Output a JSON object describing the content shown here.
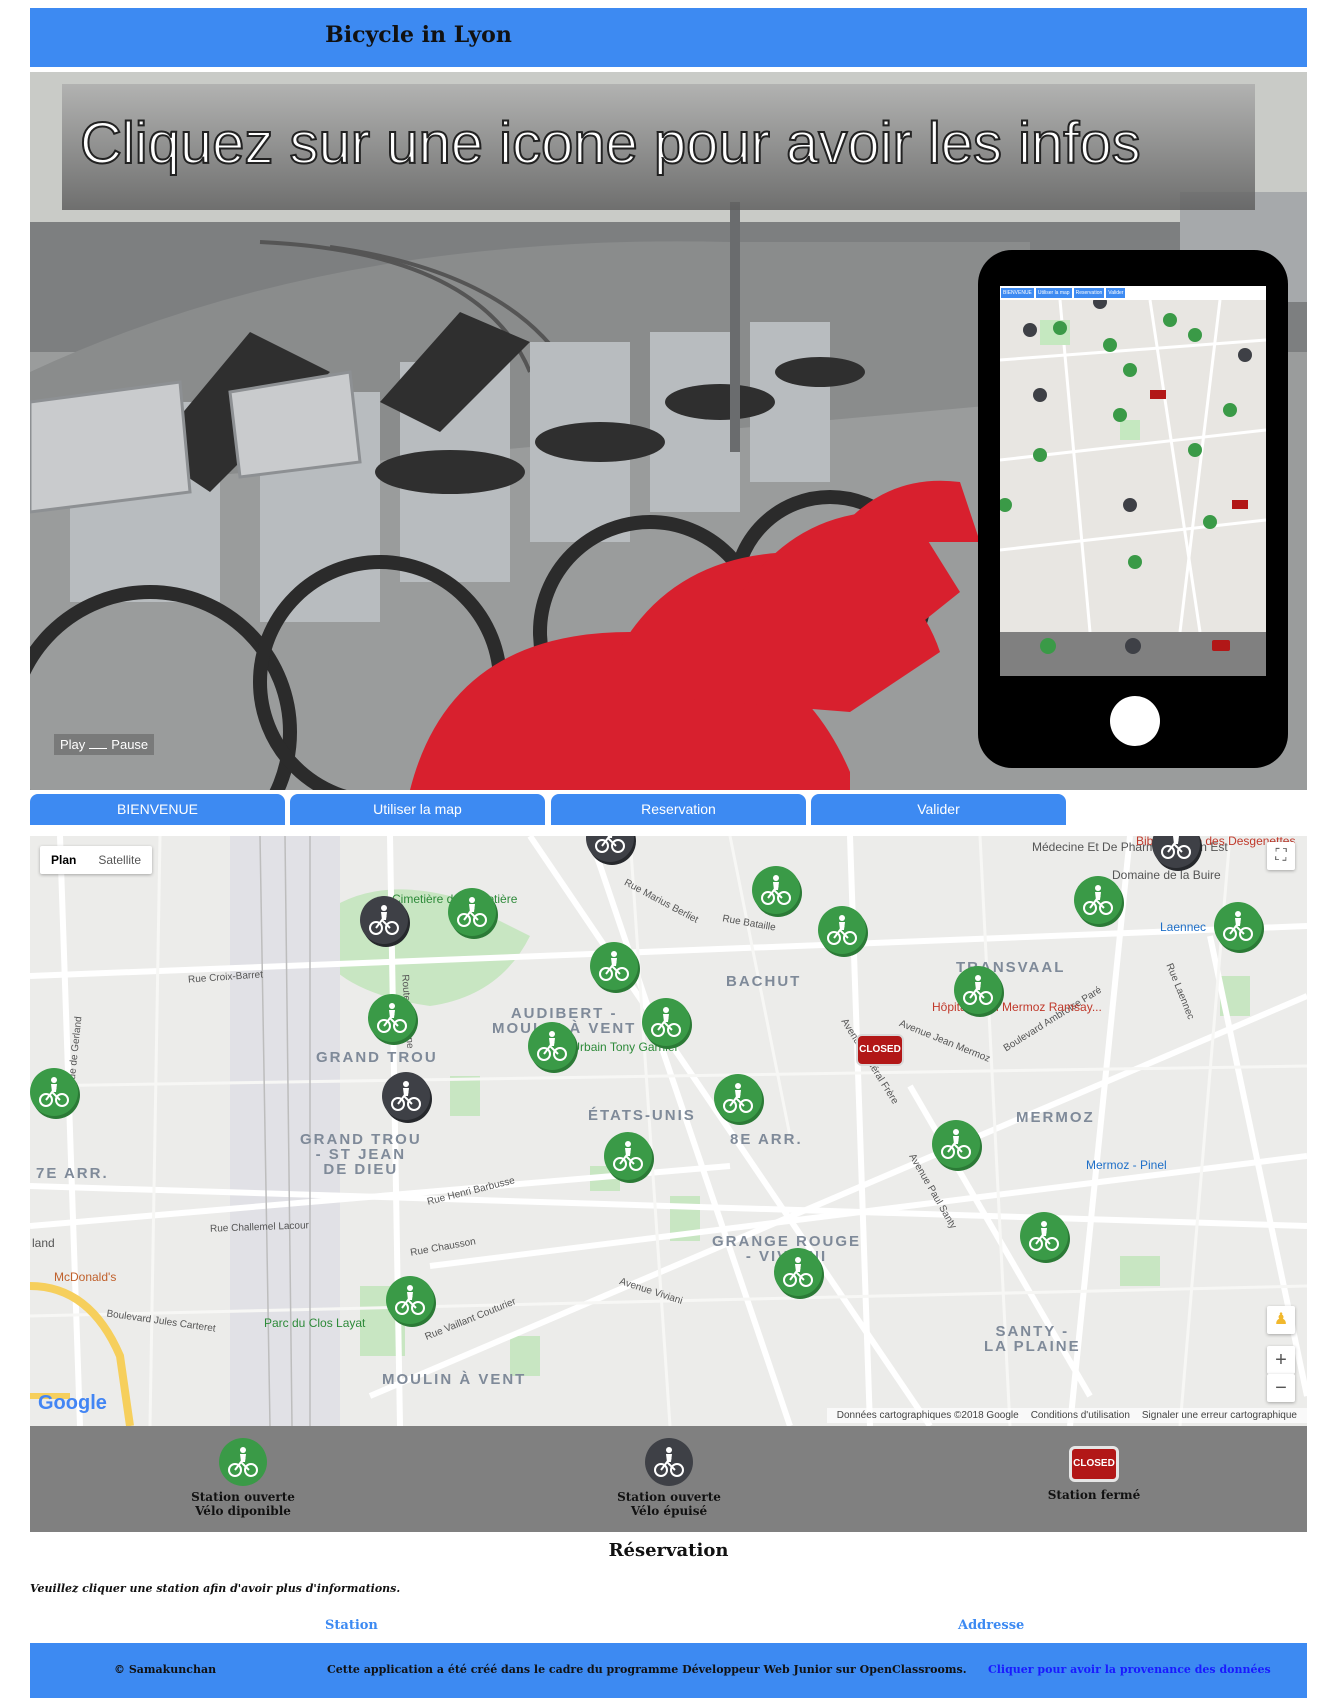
{
  "header": {
    "title": "Bicycle in Lyon"
  },
  "slider": {
    "banner_text": "Cliquez sur une icone pour avoir les infos",
    "play_label": "Play",
    "pause_label": "Pause"
  },
  "phone_preview": {
    "tabs": [
      "BIENVENUE",
      "Utiliser la map",
      "Reservation",
      "Valider"
    ]
  },
  "tabs": [
    {
      "label": "BIENVENUE"
    },
    {
      "label": "Utiliser la map"
    },
    {
      "label": "Reservation"
    },
    {
      "label": "Valider"
    }
  ],
  "map": {
    "map_type": {
      "plan": "Plan",
      "satellite": "Satellite"
    },
    "zoom_in": "+",
    "zoom_out": "−",
    "fullscreen_icon": "fullscreen-icon",
    "pegman_icon": "pegman-icon",
    "logo": "Google",
    "attribution": {
      "data": "Données cartographiques ©2018 Google",
      "terms": "Conditions d'utilisation",
      "report": "Signaler une erreur cartographique"
    },
    "closed_marker_label": "CLOSED",
    "districts": [
      "BACHUT",
      "TRANSVAAL",
      "AUDIBERT -\nMOULIN À VENT",
      "GRAND TROU",
      "ÉTATS-UNIS",
      "8E ARR.",
      "MERMOZ",
      "GRAND TROU\n- ST JEAN\nDE DIEU",
      "7E ARR.",
      "GRANGE ROUGE\n- VIVIANI",
      "SANTY -\nLA PLAINE",
      "MOULIN À VENT"
    ],
    "streets": [
      "Rue Croix-Barret",
      "Rue Marius Berliet",
      "Rue Bataille",
      "Avenue Jean Mermoz",
      "Boulevard Ambroise Paré",
      "Rue Henri Barbusse",
      "Rue Challemel Lacour",
      "Avenue Paul Santy",
      "Rue Vaillant Couturier",
      "Avenue Viviani",
      "Rue de Gerland",
      "Avenue Général Frère",
      "Rue Laennec",
      "Route de Vienne",
      "Boulevard Jules Carteret",
      "Rue Chausson"
    ],
    "pois": [
      "Cimetière de Guillotière",
      "Hôpital Jean Mermoz Ramsay...",
      "Parc du Clos Layat",
      "McDonald's",
      "Mermoz - Pinel",
      "Laennec",
      "Domaine de la Buire",
      "Médecine Et De Pharmacie Lyon Est",
      "Bibliothèque des Desgenettes",
      "Musée Urbain Tony Garnier",
      "land"
    ]
  },
  "legend": [
    {
      "line1": "Station ouverte",
      "line2": "Vélo diponible",
      "icon": "bike-station-available-icon"
    },
    {
      "line1": "Station ouverte",
      "line2": "Vélo épuisé",
      "icon": "bike-station-empty-icon"
    },
    {
      "line1": "Station fermé",
      "line2": "",
      "icon": "station-closed-icon",
      "badge": "CLOSED"
    }
  ],
  "reservation": {
    "title": "Réservation",
    "hint": "Veuillez cliquer une station afin d'avoir plus d'informations.",
    "col_station": "Station",
    "col_address": "Addresse"
  },
  "footer": {
    "copyright": "© Samakunchan",
    "note": "Cette application a été créé dans le cadre du programme Développeur Web Junior sur OpenClassrooms.",
    "source_link": "Cliquer pour avoir la provenance des données"
  },
  "colors": {
    "brand_blue": "#3d8af2",
    "station_open": "#3a9a47",
    "station_empty": "#3e4046",
    "station_closed": "#b21717",
    "legend_bg": "#808080"
  }
}
